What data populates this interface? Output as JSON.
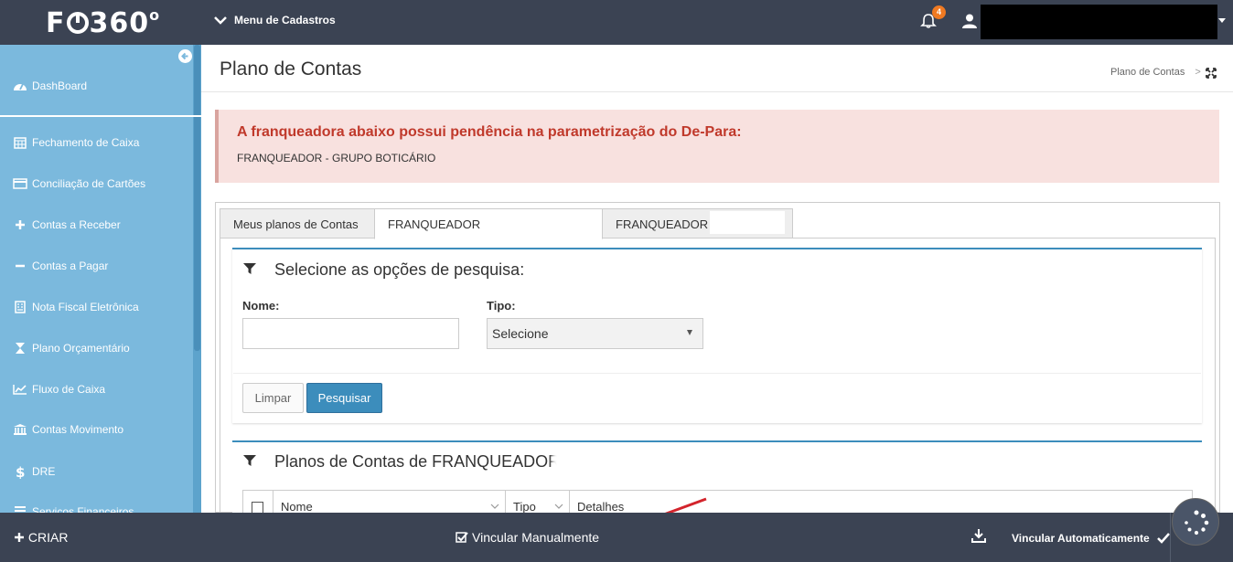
{
  "topbar": {
    "logo": "F",
    "logo_tail": "360",
    "logo_degree": "o",
    "menu_label": "Menu de Cadastros",
    "notification_count": "4"
  },
  "sidebar": {
    "items": [
      {
        "label": "DashBoard",
        "icon": "dashboard-icon"
      },
      {
        "label": "Fechamento de Caixa",
        "icon": "calendar-icon"
      },
      {
        "label": "Conciliação de Cartões",
        "icon": "credit-card-icon"
      },
      {
        "label": "Contas a Receber",
        "icon": "plus-icon"
      },
      {
        "label": "Contas a Pagar",
        "icon": "minus-icon"
      },
      {
        "label": "Nota Fiscal Eletrônica",
        "icon": "building-icon"
      },
      {
        "label": "Plano Orçamentário",
        "icon": "hourglass-icon"
      },
      {
        "label": "Fluxo de Caixa",
        "icon": "line-chart-icon"
      },
      {
        "label": "Contas Movimento",
        "icon": "bank-icon"
      },
      {
        "label": "DRE",
        "icon": "dollar-icon"
      },
      {
        "label": "Serviços Financeiros",
        "icon": "list-icon"
      }
    ]
  },
  "page": {
    "title": "Plano de Contas",
    "breadcrumb": "Plano de Contas",
    "breadcrumb_sep": ">"
  },
  "alert": {
    "title": "A franqueadora abaixo possui pendência na parametrização do De-Para:",
    "body": "FRANQUEADOR - GRUPO BOTICÁRIO"
  },
  "tabs": [
    {
      "label": "Meus planos de Contas",
      "active": false
    },
    {
      "label": "FRANQUEADOR",
      "active": true
    },
    {
      "label": "FRANQUEADOR -",
      "active": false
    }
  ],
  "search": {
    "title": "Selecione as opções de pesquisa:",
    "name_label": "Nome:",
    "name_value": "",
    "type_label": "Tipo:",
    "type_value": "Selecione",
    "clear_label": "Limpar",
    "search_label": "Pesquisar"
  },
  "results": {
    "title": "Planos de Contas de FRANQUEADOR",
    "columns": [
      "Nome",
      "Tipo",
      "Detalhes"
    ]
  },
  "bottombar": {
    "create_label": "CRIAR",
    "manual_label": "Vincular Manualmente",
    "auto_label": "Vincular Automaticamente"
  },
  "colors": {
    "topbar": "#3b4353",
    "sidebar": "#7bb9dd",
    "accent": "#3c8dbc",
    "alert_text": "#c0392b",
    "badge": "#f07a22"
  }
}
